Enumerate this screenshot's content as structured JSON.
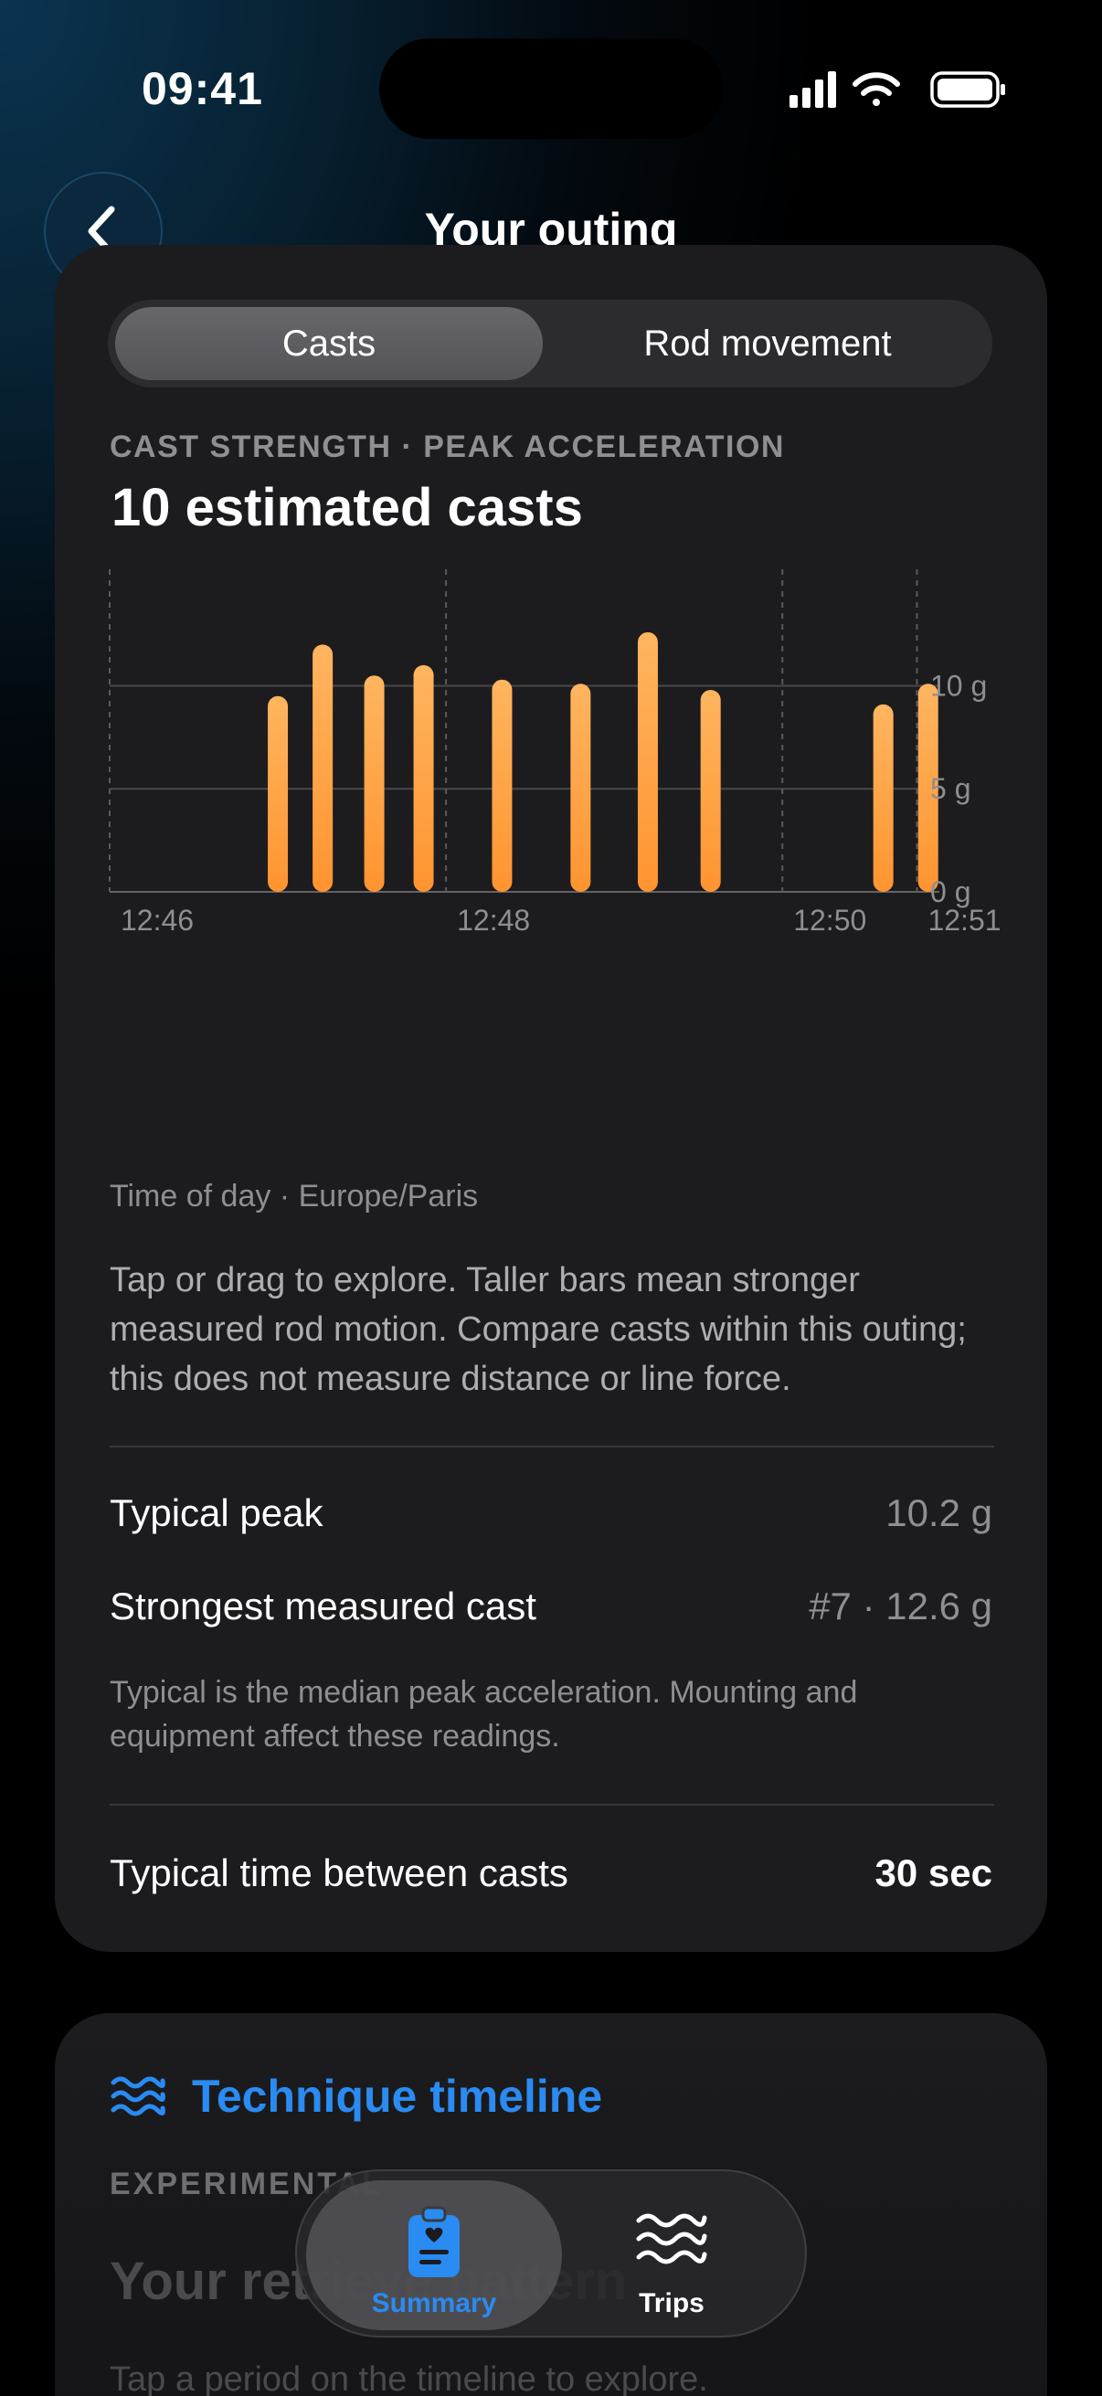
{
  "status_bar": {
    "time": "09:41"
  },
  "nav": {
    "title": "Your outing"
  },
  "segmented": {
    "options": [
      "Casts",
      "Rod movement"
    ],
    "selected": "Casts"
  },
  "casts": {
    "overline": "CAST STRENGTH · PEAK ACCELERATION",
    "headline": "10 estimated casts",
    "caption": "Time of day · Europe/Paris",
    "description": "Tap or drag to explore. Taller bars mean stronger measured rod motion. Compare casts within this outing; this does not measure distance or line force.",
    "typical_peak_label": "Typical peak",
    "typical_peak_value": "10.2 g",
    "strongest_label": "Strongest measured cast",
    "strongest_value": "#7 · 12.6 g",
    "note": "Typical is the median peak acceleration. Mounting and equipment affect these readings.",
    "interval_label": "Typical time between casts",
    "interval_value": "30 sec"
  },
  "chart_data": {
    "type": "bar",
    "x_unit": "time of day",
    "x": [
      "12:46:15",
      "12:46:35",
      "12:46:58",
      "12:47:20",
      "12:47:55",
      "12:48:30",
      "12:49:00",
      "12:49:28",
      "12:50:45",
      "12:51:05"
    ],
    "values": [
      9.5,
      12.0,
      10.5,
      11.0,
      10.3,
      10.1,
      12.6,
      9.8,
      9.1,
      10.1
    ],
    "x_ticks": [
      "12:46",
      "12:48",
      "12:50",
      "12:51"
    ],
    "y_ticks": [
      "0 g",
      "5 g",
      "10 g"
    ],
    "ylim": [
      0,
      14.5
    ],
    "bar_color": "#ff9a33",
    "grid": true
  },
  "technique": {
    "title": "Technique timeline",
    "overline": "EXPERIMENTAL",
    "big_text": "Your retrieve pattern",
    "small_text": "Tap a period on the timeline to explore."
  },
  "tabbar": {
    "items": [
      {
        "label": "Summary",
        "icon": "clipboard-heart-icon",
        "active": true,
        "color": "#2a8bf2"
      },
      {
        "label": "Trips",
        "icon": "waves-icon",
        "active": false,
        "color": "#ffffff"
      }
    ]
  }
}
